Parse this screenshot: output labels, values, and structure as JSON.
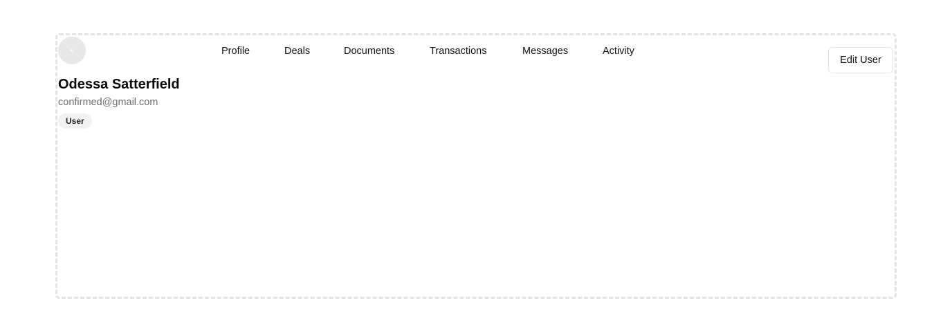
{
  "user": {
    "name": "Odessa Satterfield",
    "email": "confirmed@gmail.com",
    "role_badge": "User"
  },
  "tabs": [
    {
      "label": "Profile"
    },
    {
      "label": "Deals"
    },
    {
      "label": "Documents"
    },
    {
      "label": "Transactions"
    },
    {
      "label": "Messages"
    },
    {
      "label": "Activity"
    }
  ],
  "actions": {
    "edit_label": "Edit User"
  },
  "colors": {
    "card_border": "#e4e4e7",
    "avatar_bg": "#e8e8e8",
    "muted_text": "#6b6b74",
    "badge_bg": "#f2f2f3"
  },
  "icons": {
    "avatar": "avatar-placeholder-icon"
  }
}
